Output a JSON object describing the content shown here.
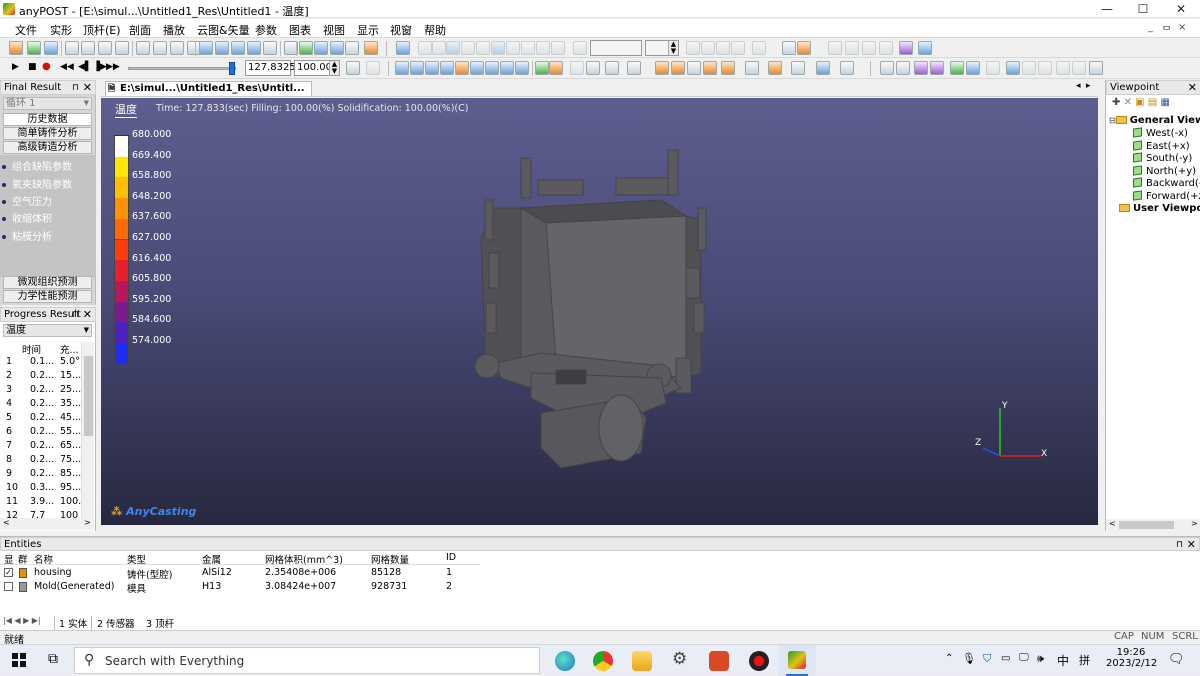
{
  "window": {
    "title": "anyPOST - [E:\\simul...\\Untitled1_Res\\Untitled1 - 温度]",
    "controls": {
      "minimize": "—",
      "maximize": "☐",
      "close": "✕"
    },
    "mdi_controls": {
      "minimize": "_",
      "restore": "ᄆ",
      "close": "×"
    }
  },
  "menu": [
    "文件",
    "实形",
    "顶杆(E)",
    "剖面",
    "播放",
    "云图&矢量",
    "参数",
    "图表",
    "视图",
    "显示",
    "视窗",
    "帮助"
  ],
  "playbar": {
    "time_value": "127.8325",
    "percent_value": "100.00"
  },
  "final_result": {
    "title": "Final Result",
    "loop_label": "循环 1",
    "buttons_top": [
      "历史数据",
      "简单铸件分析",
      "高级铸造分析"
    ],
    "items": [
      "组合缺陷参数",
      "氧夹缺陷参数",
      "空气压力",
      "收缩体积",
      "粘模分析"
    ],
    "buttons_bottom": [
      "微观组织预测",
      "力学性能预测"
    ]
  },
  "progress_result": {
    "title": "Progress Result",
    "field": "温度",
    "columns": [
      "时间",
      "充..."
    ],
    "rows": [
      [
        "1",
        "0.1...",
        "5.0°"
      ],
      [
        "2",
        "0.2...",
        "15...."
      ],
      [
        "3",
        "0.2...",
        "25...."
      ],
      [
        "4",
        "0.2...",
        "35...."
      ],
      [
        "5",
        "0.2...",
        "45...."
      ],
      [
        "6",
        "0.2...",
        "55...."
      ],
      [
        "7",
        "0.2...",
        "65...."
      ],
      [
        "8",
        "0.2...",
        "75...."
      ],
      [
        "9",
        "0.2...",
        "85...."
      ],
      [
        "10",
        "0.3...",
        "95...."
      ],
      [
        "11",
        "3.9...",
        "100."
      ],
      [
        "12",
        "7.7",
        "100"
      ]
    ]
  },
  "document_tab": "E:\\simul...\\Untitled1_Res\\Untitl...",
  "viewport": {
    "field_label": "温度",
    "info": "Time: 127.833(sec)  Filling: 100.00(%)  Solidification: 100.00(%)(C)",
    "legend": [
      {
        "value": "680.000",
        "color": "#ffffff"
      },
      {
        "value": "669.400",
        "color": "#ffe600"
      },
      {
        "value": "658.800",
        "color": "#ffbf00"
      },
      {
        "value": "648.200",
        "color": "#ff9200"
      },
      {
        "value": "637.600",
        "color": "#ff6a00"
      },
      {
        "value": "627.000",
        "color": "#ff3c0a"
      },
      {
        "value": "616.400",
        "color": "#e8202a"
      },
      {
        "value": "605.800",
        "color": "#b8175c"
      },
      {
        "value": "595.200",
        "color": "#7d1a8f"
      },
      {
        "value": "584.600",
        "color": "#4b21c2"
      },
      {
        "value": "574.000",
        "color": "#1e2df0"
      }
    ],
    "brand": "AnyCasting",
    "axes": {
      "x": "X",
      "y": "Y",
      "z": "Z"
    }
  },
  "viewpoint": {
    "title": "Viewpoint",
    "general_label": "General Viewp",
    "items": [
      "West(-x)",
      "East(+x)",
      "South(-y)",
      "North(+y)",
      "Backward(-z)",
      "Forward(+z)"
    ],
    "user_label": "User Viewpoir"
  },
  "entities": {
    "title": "Entities",
    "columns": [
      "显",
      "群",
      "名称",
      "类型",
      "金属",
      "网格体积(mm^3)",
      "网格数量",
      "ID"
    ],
    "rows": [
      {
        "checked": true,
        "color": "#f08a00",
        "name": "housing",
        "type": "铸件(型腔)",
        "metal": "AlSi12",
        "volume": "2.35408e+006",
        "count": "85128",
        "id": "1"
      },
      {
        "checked": false,
        "color": "#9a9a9a",
        "name": "Mold(Generated)",
        "type": "模具",
        "metal": "H13",
        "volume": "3.08424e+007",
        "count": "928731",
        "id": "2"
      }
    ],
    "tabs": [
      "1 实体",
      "2 传感器",
      "3 顶杆"
    ]
  },
  "status": {
    "text": "就绪",
    "indicators": [
      "CAP",
      "NUM",
      "SCRL"
    ]
  },
  "taskbar": {
    "search_placeholder": "Search with Everything",
    "tray_ime": "中",
    "tray_ime2": "拼",
    "time": "19:26",
    "date": "2023/2/12"
  }
}
